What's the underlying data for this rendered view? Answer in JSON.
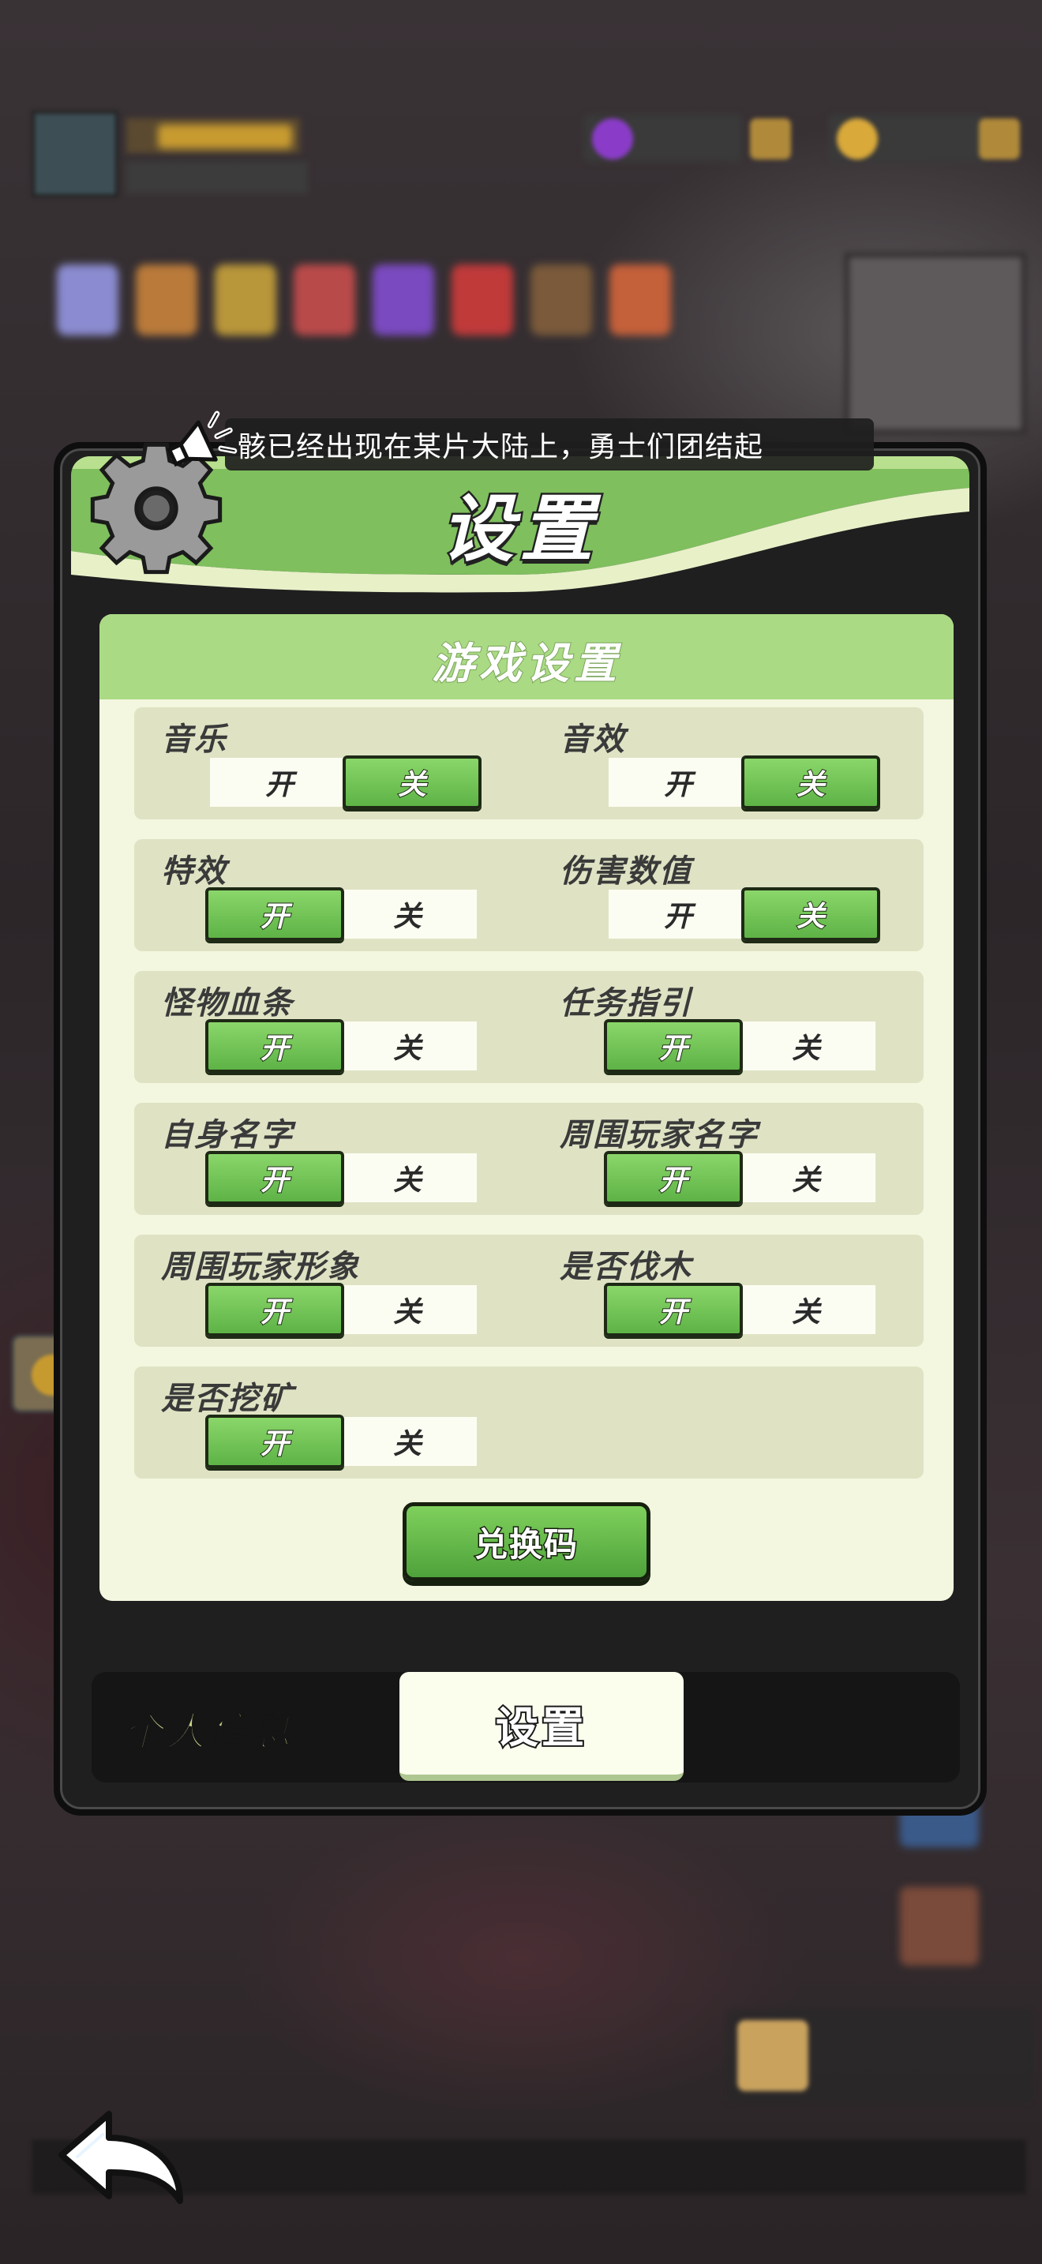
{
  "announcement": "骸已经出现在某片大陆上，勇士们团结起",
  "panel_title": "设置",
  "section_title": "游戏设置",
  "on_label": "开",
  "off_label": "关",
  "settings": [
    {
      "label": "音乐",
      "state": "off"
    },
    {
      "label": "音效",
      "state": "off"
    },
    {
      "label": "特效",
      "state": "on"
    },
    {
      "label": "伤害数值",
      "state": "off"
    },
    {
      "label": "怪物血条",
      "state": "on"
    },
    {
      "label": "任务指引",
      "state": "on"
    },
    {
      "label": "自身名字",
      "state": "on"
    },
    {
      "label": "周围玩家名字",
      "state": "on"
    },
    {
      "label": "周围玩家形象",
      "state": "on"
    },
    {
      "label": "是否伐木",
      "state": "on"
    },
    {
      "label": "是否挖矿",
      "state": "on"
    }
  ],
  "redeem_button": "兑换码",
  "tabs": {
    "profile": "个人信息",
    "settings": "设置"
  },
  "colors": {
    "accent_green": "#5eb346",
    "header_green": "#aada84",
    "content_bg": "#f3f7df"
  }
}
